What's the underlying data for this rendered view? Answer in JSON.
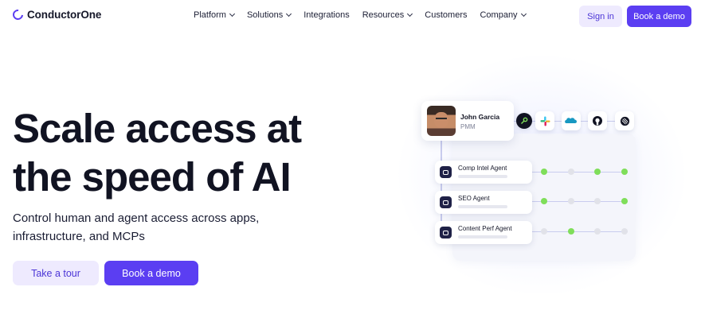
{
  "brand": {
    "name": "ConductorOne",
    "accent": "#5b3ef2",
    "soft_accent": "#eeeafe"
  },
  "nav": {
    "items": [
      {
        "label": "Platform",
        "dropdown": true
      },
      {
        "label": "Solutions",
        "dropdown": true
      },
      {
        "label": "Integrations",
        "dropdown": false
      },
      {
        "label": "Resources",
        "dropdown": true
      },
      {
        "label": "Customers",
        "dropdown": false
      },
      {
        "label": "Company",
        "dropdown": true
      }
    ],
    "sign_in": "Sign in",
    "book_demo": "Book a demo"
  },
  "hero": {
    "title_lines": [
      "Scale access at",
      "the speed of AI"
    ],
    "subtitle_lines": [
      "Control human and agent access across apps,",
      "infrastructure, and MCPs"
    ],
    "primary_cta": "Book a demo",
    "secondary_cta": "Take a tour"
  },
  "illustration": {
    "user": {
      "name": "John Garcia",
      "role": "PMM"
    },
    "apps": [
      "key-app-icon",
      "slack-icon",
      "salesforce-icon",
      "github-icon",
      "linear-icon"
    ],
    "agents": [
      {
        "name": "Comp Intel Agent",
        "status": [
          true,
          false,
          true,
          true
        ]
      },
      {
        "name": "SEO Agent",
        "status": [
          true,
          false,
          false,
          true
        ]
      },
      {
        "name": "Content Perf Agent",
        "status": [
          false,
          true,
          false,
          false
        ]
      }
    ],
    "status_colors": {
      "on": "#7fde5a",
      "off": "#e1e2e9"
    }
  }
}
